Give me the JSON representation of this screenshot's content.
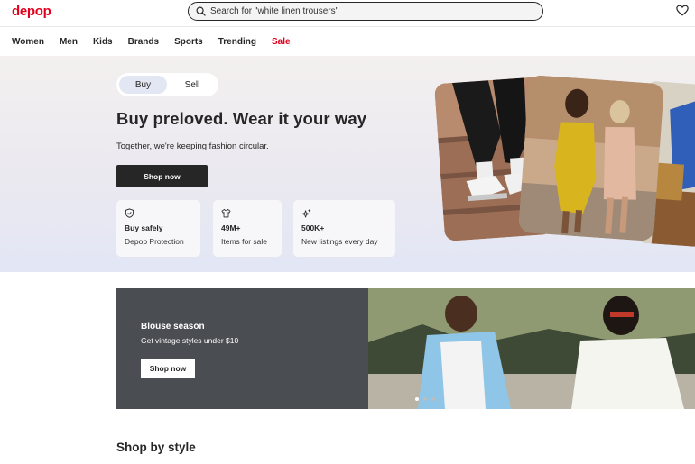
{
  "brand": {
    "logo_text": "depop",
    "accent_color": "#e3001b"
  },
  "search": {
    "placeholder": "Search for \"white linen trousers\"",
    "icon": "search-icon"
  },
  "header": {
    "favorites_icon": "heart-icon"
  },
  "nav": {
    "items": [
      {
        "label": "Women"
      },
      {
        "label": "Men"
      },
      {
        "label": "Kids"
      },
      {
        "label": "Brands"
      },
      {
        "label": "Sports"
      },
      {
        "label": "Trending"
      },
      {
        "label": "Sale",
        "highlight": true,
        "color": "#e3001b"
      }
    ]
  },
  "hero": {
    "toggle": {
      "buy_label": "Buy",
      "sell_label": "Sell",
      "selected": "Buy"
    },
    "title": "Buy preloved. Wear it your way",
    "subtitle": "Together, we're keeping fashion circular.",
    "cta_label": "Shop now",
    "cards": [
      {
        "icon": "shield-icon",
        "title": "Buy safely",
        "text": "Depop Protection"
      },
      {
        "icon": "tshirt-icon",
        "title": "49M+",
        "text": "Items for sale"
      },
      {
        "icon": "sparkle-icon",
        "title": "500K+",
        "text": "New listings every day"
      }
    ]
  },
  "banner": {
    "title": "Blouse season",
    "subtitle": "Get vintage styles under $10",
    "cta_label": "Shop now",
    "background_color": "#4a4d52",
    "carousel": {
      "count": 3,
      "active_index": 0
    }
  },
  "shop_by_style": {
    "title": "Shop by style"
  }
}
